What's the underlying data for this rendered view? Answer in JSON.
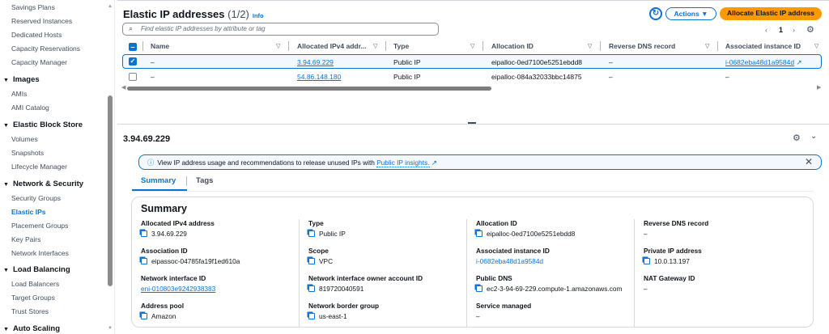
{
  "sidebar": {
    "items_top": [
      "Savings Plans",
      "Reserved Instances",
      "Dedicated Hosts",
      "Capacity Reservations",
      "Capacity Manager"
    ],
    "sections": [
      {
        "title": "Images",
        "items": [
          "AMIs",
          "AMI Catalog"
        ]
      },
      {
        "title": "Elastic Block Store",
        "items": [
          "Volumes",
          "Snapshots",
          "Lifecycle Manager"
        ]
      },
      {
        "title": "Network & Security",
        "items": [
          "Security Groups",
          "Elastic IPs",
          "Placement Groups",
          "Key Pairs",
          "Network Interfaces"
        ]
      },
      {
        "title": "Load Balancing",
        "items": [
          "Load Balancers",
          "Target Groups",
          "Trust Stores"
        ]
      },
      {
        "title": "Auto Scaling",
        "items": []
      }
    ],
    "active": "Elastic IPs"
  },
  "header": {
    "title": "Elastic IP addresses",
    "count": "(1/2)",
    "info": "Info",
    "actions": "Actions",
    "allocate": "Allocate Elastic IP address",
    "search_placeholder": "Find elastic IP addresses by attribute or tag",
    "page": "1"
  },
  "table": {
    "columns": [
      "Name",
      "Allocated IPv4 addr...",
      "Type",
      "Allocation ID",
      "Reverse DNS record",
      "Associated instance ID"
    ],
    "rows": [
      {
        "selected": true,
        "name": "–",
        "ip": "3.94.69.229",
        "type": "Public IP",
        "alloc": "eipalloc-0ed7100e5251ebdd8",
        "rdns": "–",
        "instance": "i-0682eba48d1a9584d"
      },
      {
        "selected": false,
        "name": "–",
        "ip": "54.86.148.180",
        "type": "Public IP",
        "alloc": "eipalloc-084a32033bbc14875",
        "rdns": "–",
        "instance": "–"
      }
    ]
  },
  "detail": {
    "title": "3.94.69.229",
    "banner_text": "View IP address usage and recommendations to release unused IPs with ",
    "banner_link": "Public IP insights.",
    "tabs": [
      "Summary",
      "Tags"
    ],
    "summary_title": "Summary",
    "fields": [
      {
        "label": "Allocated IPv4 address",
        "value": "3.94.69.229"
      },
      {
        "label": "Association ID",
        "value": "eipassoc-04785fa19f1ed610a"
      },
      {
        "label": "Network interface ID",
        "value": "eni-010803e9242938383"
      },
      {
        "label": "Address pool",
        "value": "Amazon"
      },
      {
        "label": "Type",
        "value": "Public IP"
      },
      {
        "label": "Scope",
        "value": "VPC"
      },
      {
        "label": "Network interface owner account ID",
        "value": "819720040591"
      },
      {
        "label": "Network border group",
        "value": "us-east-1"
      },
      {
        "label": "Allocation ID",
        "value": "eipalloc-0ed7100e5251ebdd8"
      },
      {
        "label": "Associated instance ID",
        "value": "i-0682eba48d1a9584d"
      },
      {
        "label": "Public DNS",
        "value": "ec2-3-94-69-229.compute-1.amazonaws.com"
      },
      {
        "label": "Service managed",
        "value": "–"
      },
      {
        "label": "Reverse DNS record",
        "value": "–"
      },
      {
        "label": "Private IP address",
        "value": "10.0.13.197"
      },
      {
        "label": "NAT Gateway ID",
        "value": "–"
      }
    ]
  },
  "colors": {
    "accent": "#0972d3",
    "primary_button": "#ff9900"
  }
}
